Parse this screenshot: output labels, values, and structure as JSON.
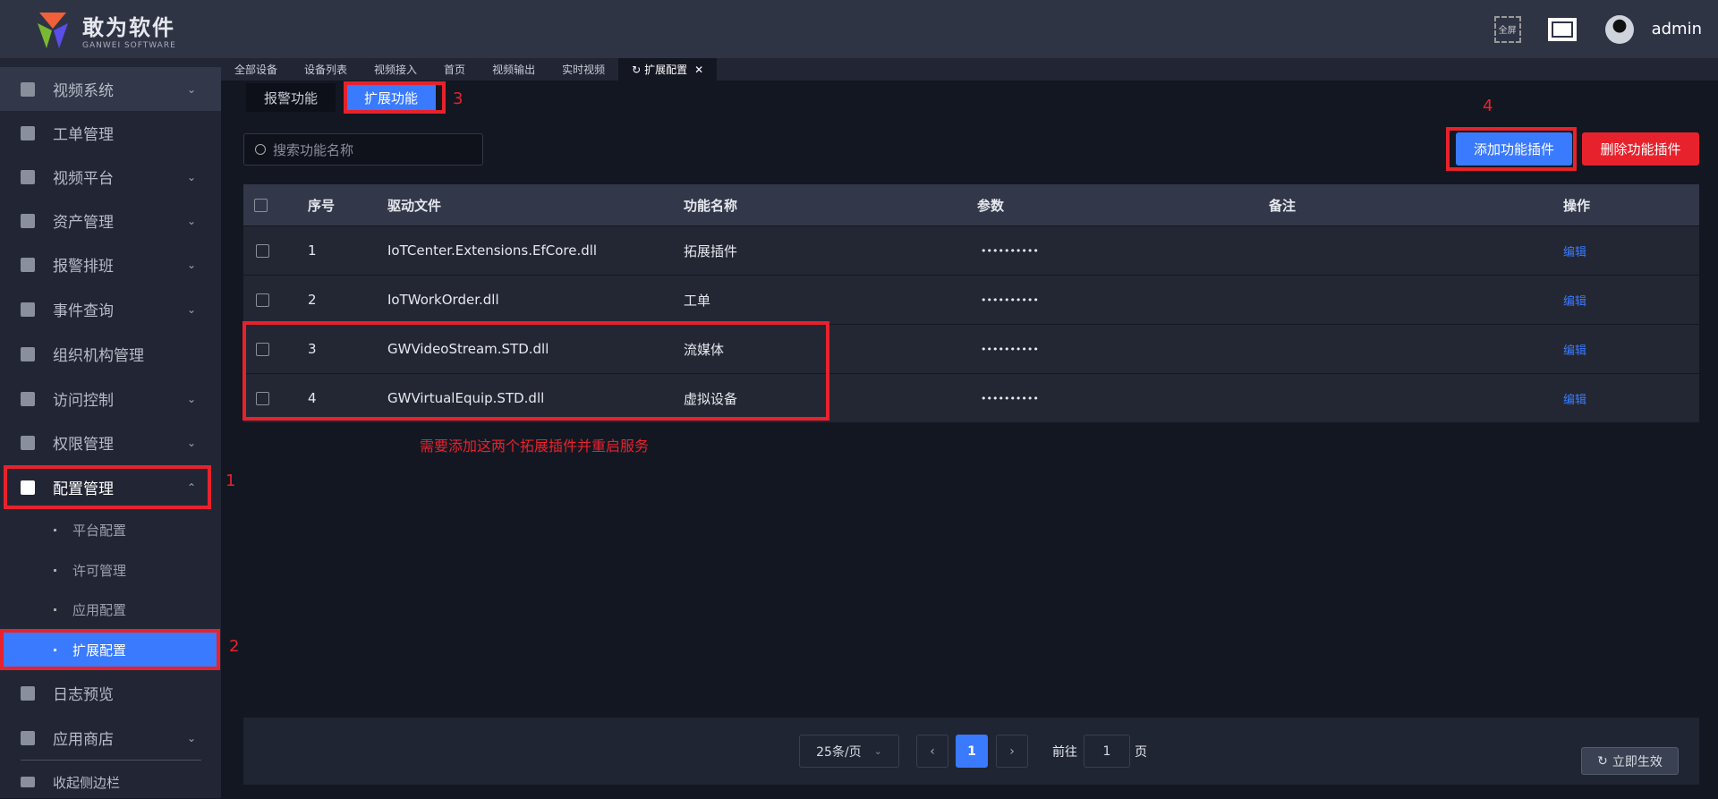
{
  "logo": {
    "cn": "敢为软件",
    "en": "GANWEI SOFTWARE"
  },
  "header": {
    "fullscreen": "全屏",
    "user": "admin"
  },
  "sidebar": {
    "items": [
      {
        "label": "视频系统",
        "chev": "⌄"
      },
      {
        "label": "工单管理"
      },
      {
        "label": "视频平台",
        "chev": "⌄"
      },
      {
        "label": "资产管理",
        "chev": "⌄"
      },
      {
        "label": "报警排班",
        "chev": "⌄"
      },
      {
        "label": "事件查询",
        "chev": "⌄"
      },
      {
        "label": "组织机构管理"
      },
      {
        "label": "访问控制",
        "chev": "⌄"
      },
      {
        "label": "权限管理",
        "chev": "⌄"
      },
      {
        "label": "配置管理",
        "chev": "⌃"
      }
    ],
    "sub": [
      "平台配置",
      "许可管理",
      "应用配置",
      "扩展配置"
    ],
    "after": [
      {
        "label": "日志预览"
      },
      {
        "label": "应用商店",
        "chev": "⌄"
      }
    ],
    "collapse": "收起侧边栏"
  },
  "tabs": [
    "全部设备",
    "设备列表",
    "视频接入",
    "首页",
    "视频输出",
    "实时视频"
  ],
  "active_tab": "扩展配置",
  "active_tab_close": "✕",
  "subtabs": [
    "报警功能",
    "扩展功能"
  ],
  "search": {
    "placeholder": "搜索功能名称"
  },
  "buttons": {
    "add": "添加功能插件",
    "delete": "删除功能插件"
  },
  "table": {
    "headers": [
      "序号",
      "驱动文件",
      "功能名称",
      "参数",
      "备注",
      "操作"
    ],
    "rows": [
      {
        "no": "1",
        "file": "IoTCenter.Extensions.EfCore.dll",
        "name": "拓展插件",
        "param": "••••••••••",
        "note": "",
        "op": "编辑"
      },
      {
        "no": "2",
        "file": "IoTWorkOrder.dll",
        "name": "工单",
        "param": "••••••••••",
        "note": "",
        "op": "编辑"
      },
      {
        "no": "3",
        "file": "GWVideoStream.STD.dll",
        "name": "流媒体",
        "param": "••••••••••",
        "note": "",
        "op": "编辑"
      },
      {
        "no": "4",
        "file": "GWVirtualEquip.STD.dll",
        "name": "虚拟设备",
        "param": "••••••••••",
        "note": "",
        "op": "编辑"
      }
    ]
  },
  "annotations": {
    "n1": "1",
    "n2": "2",
    "n3": "3",
    "n4": "4",
    "note": "需要添加这两个拓展插件并重启服务"
  },
  "pager": {
    "size": "25条/页",
    "page": "1",
    "goto": "前往",
    "goto_val": "1",
    "page_unit": "页",
    "apply": "立即生效"
  }
}
